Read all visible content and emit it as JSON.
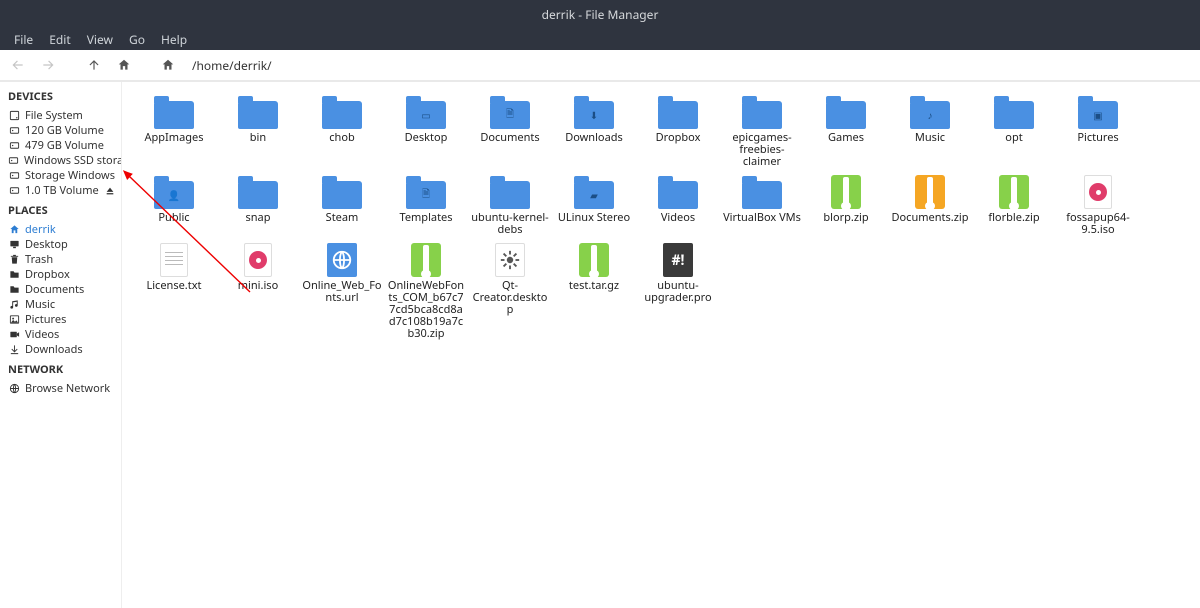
{
  "titlebar": "derrik - File Manager",
  "menubar": [
    "File",
    "Edit",
    "View",
    "Go",
    "Help"
  ],
  "path": "/home/derrik/",
  "sidebar": {
    "devices_label": "DEVICES",
    "devices": [
      {
        "label": "File System",
        "icon": "disk"
      },
      {
        "label": "120 GB Volume",
        "icon": "hdd"
      },
      {
        "label": "479 GB Volume",
        "icon": "hdd"
      },
      {
        "label": "Windows SSD storage",
        "icon": "hdd"
      },
      {
        "label": "Storage Windows",
        "icon": "hdd"
      },
      {
        "label": "1.0 TB Volume",
        "icon": "hdd",
        "eject": true
      }
    ],
    "places_label": "PLACES",
    "places": [
      {
        "label": "derrik",
        "icon": "home",
        "active": true
      },
      {
        "label": "Desktop",
        "icon": "desktop"
      },
      {
        "label": "Trash",
        "icon": "trash"
      },
      {
        "label": "Dropbox",
        "icon": "folder"
      },
      {
        "label": "Documents",
        "icon": "folder"
      },
      {
        "label": "Music",
        "icon": "music"
      },
      {
        "label": "Pictures",
        "icon": "picture"
      },
      {
        "label": "Videos",
        "icon": "video"
      },
      {
        "label": "Downloads",
        "icon": "download"
      }
    ],
    "network_label": "NETWORK",
    "network": [
      {
        "label": "Browse Network",
        "icon": "network"
      }
    ]
  },
  "items": [
    {
      "name": "AppImages",
      "kind": "folder"
    },
    {
      "name": "bin",
      "kind": "folder"
    },
    {
      "name": "chob",
      "kind": "folder"
    },
    {
      "name": "Desktop",
      "kind": "folder",
      "badge": "▭"
    },
    {
      "name": "Documents",
      "kind": "folder",
      "badge": "🗎"
    },
    {
      "name": "Downloads",
      "kind": "folder",
      "badge": "⬇"
    },
    {
      "name": "Dropbox",
      "kind": "folder"
    },
    {
      "name": "epicgames-freebies-claimer",
      "kind": "folder"
    },
    {
      "name": "Games",
      "kind": "folder"
    },
    {
      "name": "Music",
      "kind": "folder",
      "badge": "♪"
    },
    {
      "name": "opt",
      "kind": "folder"
    },
    {
      "name": "Pictures",
      "kind": "folder",
      "badge": "▣"
    },
    {
      "name": "Public",
      "kind": "folder",
      "badge": "👤"
    },
    {
      "name": "snap",
      "kind": "folder"
    },
    {
      "name": "Steam",
      "kind": "folder"
    },
    {
      "name": "Templates",
      "kind": "folder",
      "badge": "🗎"
    },
    {
      "name": "ubuntu-kernel-debs",
      "kind": "folder"
    },
    {
      "name": "ULinux Stereo",
      "kind": "folder",
      "badge": "▰"
    },
    {
      "name": "Videos",
      "kind": "folder"
    },
    {
      "name": "VirtualBox VMs",
      "kind": "folder"
    },
    {
      "name": "blorp.zip",
      "kind": "zip-green"
    },
    {
      "name": "Documents.zip",
      "kind": "zip-orange"
    },
    {
      "name": "florble.zip",
      "kind": "zip-green"
    },
    {
      "name": "fossapup64-9.5.iso",
      "kind": "iso"
    },
    {
      "name": "License.txt",
      "kind": "txt"
    },
    {
      "name": "mini.iso",
      "kind": "iso"
    },
    {
      "name": "Online_Web_Fonts.url",
      "kind": "url"
    },
    {
      "name": "OnlineWebFonts_COM_b67c77cd5bca8cd8ad7c108b19a7cb30.zip",
      "kind": "zip-green"
    },
    {
      "name": "Qt-Creator.desktop",
      "kind": "desktop"
    },
    {
      "name": "test.tar.gz",
      "kind": "zip-green"
    },
    {
      "name": "ubuntu-upgrader.pro",
      "kind": "pro"
    }
  ]
}
